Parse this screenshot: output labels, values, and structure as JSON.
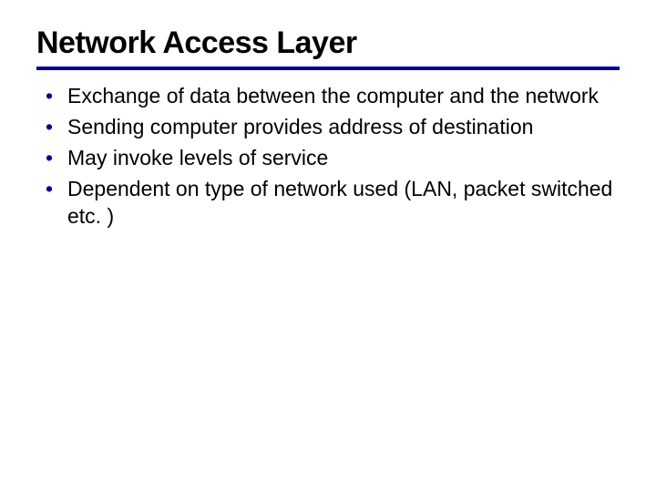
{
  "title": "Network Access Layer",
  "bullets": [
    "Exchange of data between the computer and the network",
    "Sending computer provides address of destination",
    "May invoke levels of service",
    "Dependent on type of network used (LAN, packet switched etc. )"
  ]
}
